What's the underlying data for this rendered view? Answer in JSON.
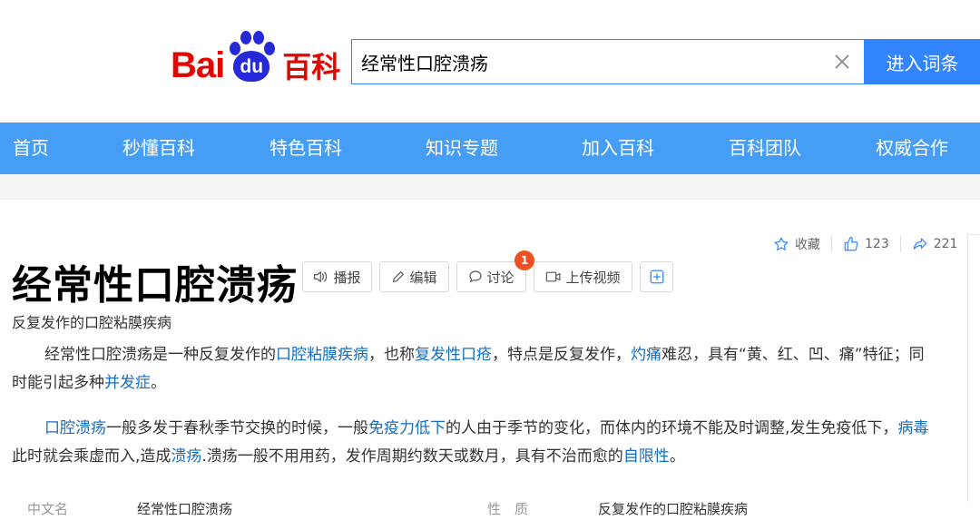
{
  "logo": {
    "bai": "Bai",
    "du": "du",
    "baike": "百科"
  },
  "search": {
    "value": "经常性口腔溃疡",
    "button_label": "进入词条"
  },
  "nav": {
    "items": [
      "首页",
      "秒懂百科",
      "特色百科",
      "知识专题",
      "加入百科",
      "百科团队",
      "权威合作"
    ]
  },
  "tools": {
    "favorite_label": "收藏",
    "like_count": "123",
    "share_count": "221"
  },
  "entry": {
    "title": "经常性口腔溃疡",
    "subtitle": "反复发作的口腔粘膜疾病",
    "actions": {
      "play": "播报",
      "edit": "编辑",
      "discuss": "讨论",
      "discuss_badge": "1",
      "upload_video": "上传视频"
    }
  },
  "paragraphs": [
    [
      {
        "text": "经常性口腔溃疡是一种反复发作的"
      },
      {
        "text": "口腔粘膜疾病",
        "link": true
      },
      {
        "text": "，也称"
      },
      {
        "text": "复发性口疮",
        "link": true
      },
      {
        "text": "，特点是反复发作，"
      },
      {
        "text": "灼痛",
        "link": true
      },
      {
        "text": "难忍，具有“黄、红、凹、痛”特征；同时能引起多种"
      },
      {
        "text": "并发症",
        "link": true
      },
      {
        "text": "。"
      }
    ],
    [
      {
        "text": "口腔溃疡",
        "link": true
      },
      {
        "text": "一般多发于春秋季节交换的时候，一般"
      },
      {
        "text": "免疫力低下",
        "link": true
      },
      {
        "text": "的人由于季节的变化，而体内的环境不能及时调整,发生免疫低下，"
      },
      {
        "text": "病毒",
        "link": true
      },
      {
        "text": "此时就会乘虚而入,造成"
      },
      {
        "text": "溃疡",
        "link": true
      },
      {
        "text": ".溃疡一般不用用药，发作周期约数天或数月，具有不治而愈的"
      },
      {
        "text": "自限性",
        "link": true
      },
      {
        "text": "。"
      }
    ]
  ],
  "basic_info": [
    {
      "label": "中文名",
      "value": "经常性口腔溃疡"
    },
    {
      "label": "性　质",
      "value": "反复发作的口腔粘膜疾病"
    }
  ],
  "colors": {
    "brand_red": "#e10602",
    "brand_blue": "#2529d8",
    "nav_blue": "#459df5",
    "search_blue": "#3385ff",
    "link": "#136ec2",
    "badge": "#f04e23"
  }
}
